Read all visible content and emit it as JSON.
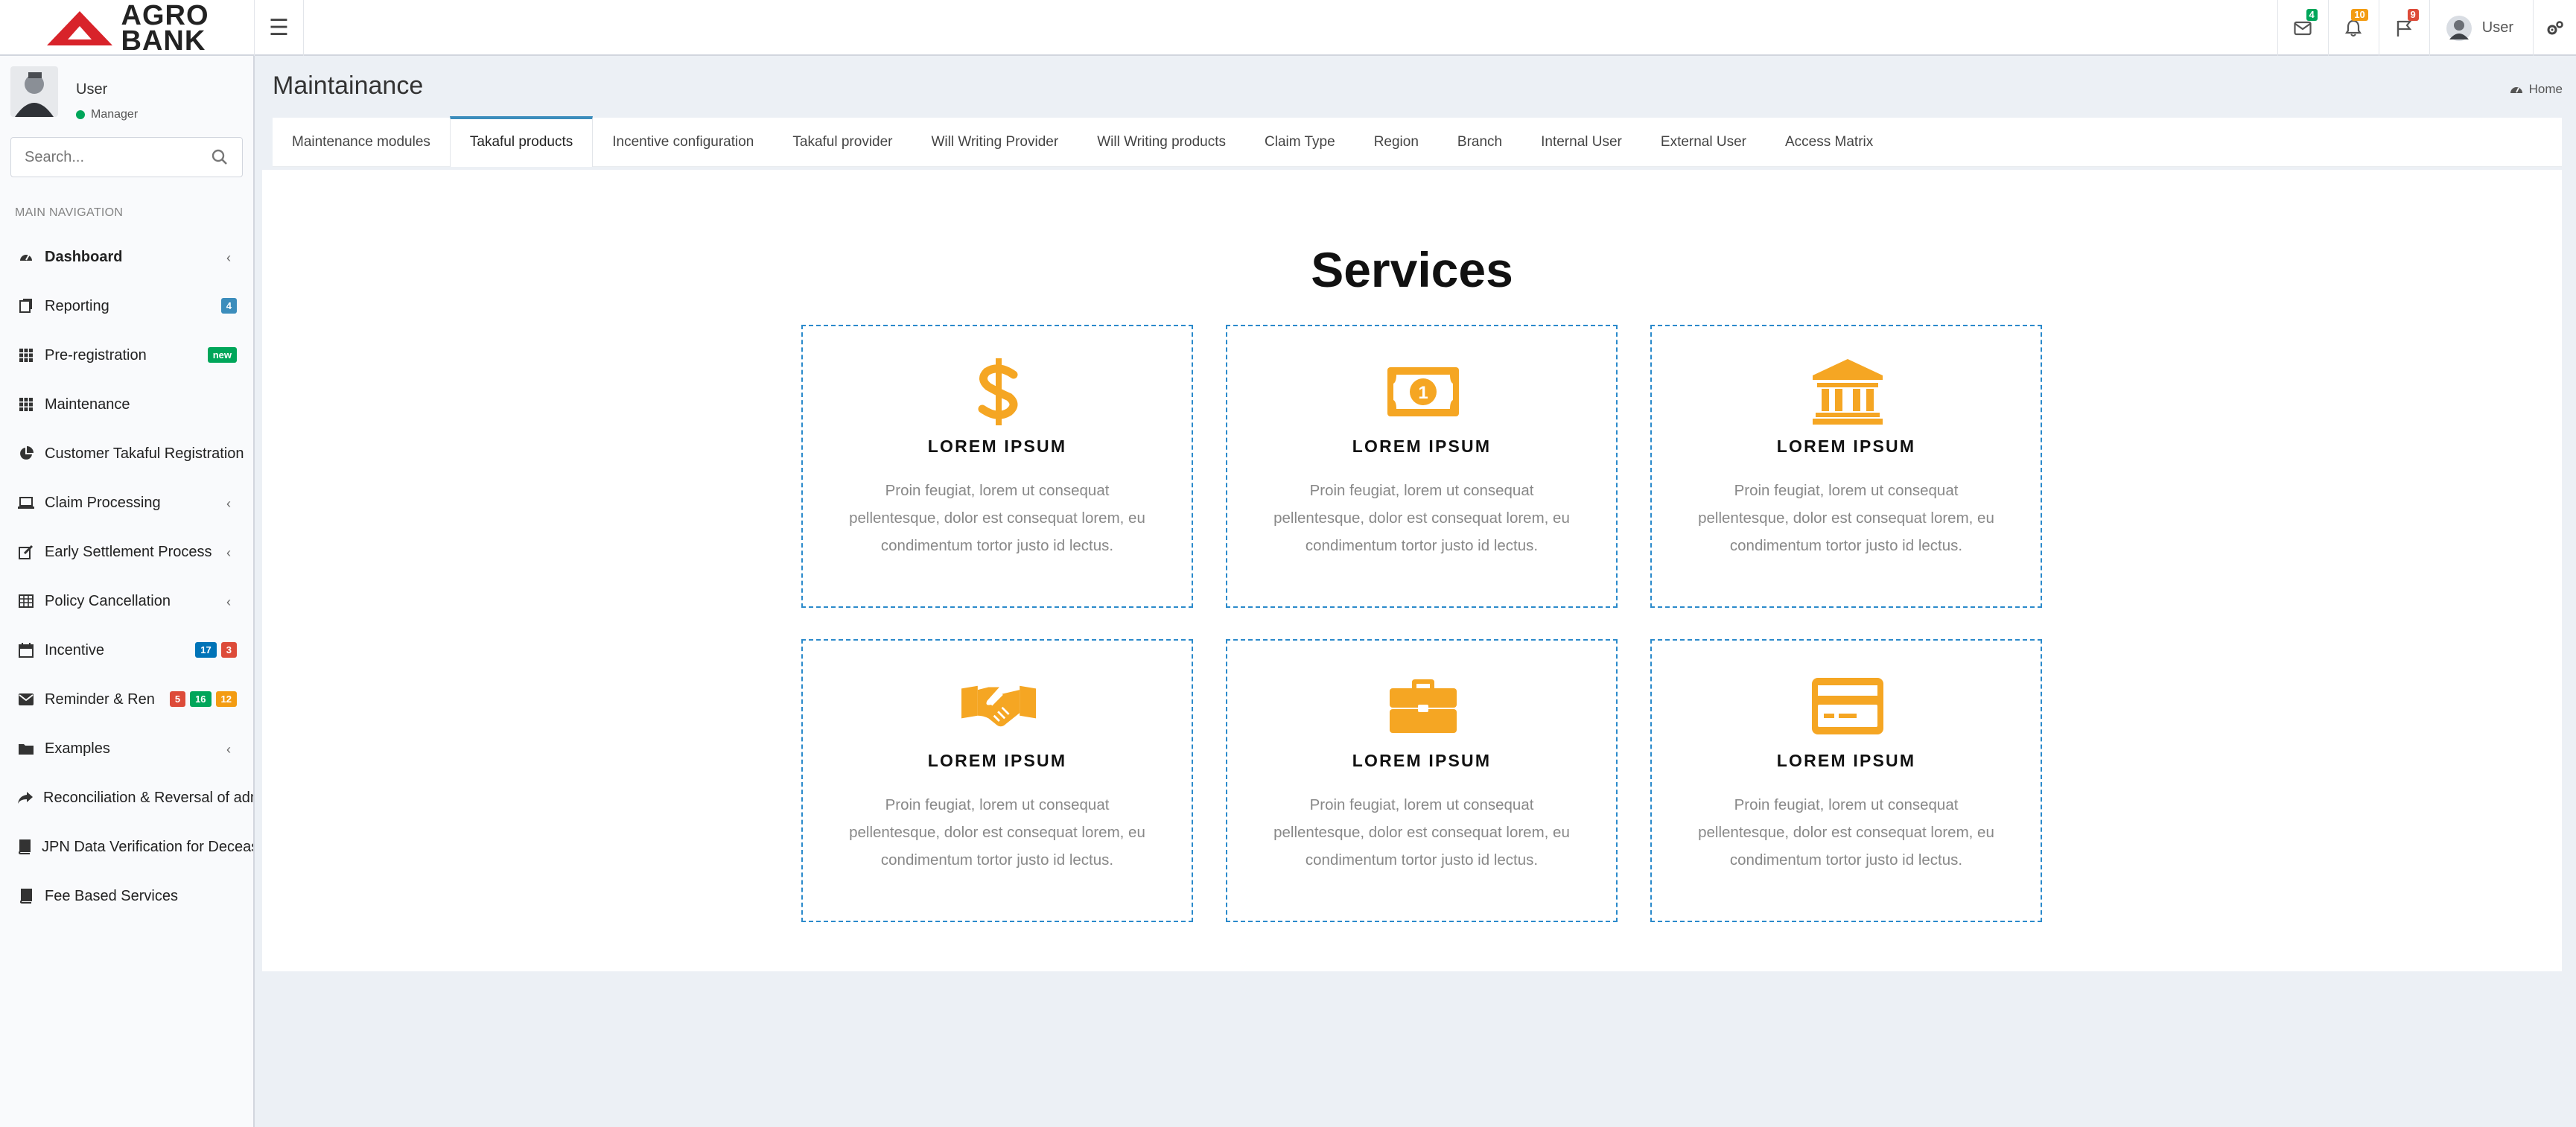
{
  "brand": {
    "logo_text_line1": "AGRO",
    "logo_text_line2": "BANK",
    "red": "#d8232a"
  },
  "header": {
    "badges": {
      "messages": "4",
      "notifications": "10",
      "tasks": "9"
    },
    "user_label": "User"
  },
  "sidebar": {
    "user": {
      "name": "User",
      "role": "Manager"
    },
    "search": {
      "placeholder": "Search..."
    },
    "nav_header": "MAIN NAVIGATION",
    "items": [
      {
        "label": "Dashboard",
        "icon": "dashboard-icon"
      },
      {
        "label": "Reporting",
        "icon": "reporting-icon",
        "badge": "4"
      },
      {
        "label": "Pre-registration",
        "icon": "grid-icon",
        "badge": "new"
      },
      {
        "label": "Maintenance",
        "icon": "grid-icon"
      },
      {
        "label": "Customer Takaful Registration",
        "icon": "pie-chart-icon"
      },
      {
        "label": "Claim Processing",
        "icon": "laptop-icon"
      },
      {
        "label": "Early Settlement Process",
        "icon": "edit-icon"
      },
      {
        "label": "Policy Cancellation",
        "icon": "table-icon"
      },
      {
        "label": "Incentive",
        "icon": "calendar-icon",
        "badges": [
          "17",
          "3"
        ]
      },
      {
        "label": "Reminder & Renewal",
        "icon": "envelope-icon",
        "badges": [
          "5",
          "16",
          "12"
        ]
      },
      {
        "label": "Examples",
        "icon": "folder-icon"
      },
      {
        "label": "Reconciliation & Reversal of admin",
        "icon": "share-icon"
      },
      {
        "label": "JPN Data Verification for Deceased",
        "icon": "book-icon"
      },
      {
        "label": "Fee Based Services",
        "icon": "book-icon"
      }
    ]
  },
  "content": {
    "page_title": "Maintainance",
    "breadcrumb_home": "Home",
    "tabs": [
      "Maintenance modules",
      "Takaful products",
      "Incentive configuration",
      "Takaful provider",
      "Will Writing Provider",
      "Will Writing products",
      "Claim Type",
      "Region",
      "Branch",
      "Internal User",
      "External User",
      "Access Matrix"
    ],
    "active_tab": "Takaful products",
    "services_title": "Services",
    "cards": [
      {
        "icon": "dollar-icon",
        "title": "LOREM IPSUM",
        "desc": "Proin feugiat, lorem ut consequat pellentesque, dolor est consequat lorem, eu condimentum tortor justo id lectus."
      },
      {
        "icon": "money-bill-icon",
        "title": "LOREM IPSUM",
        "desc": "Proin feugiat, lorem ut consequat pellentesque, dolor est consequat lorem, eu condimentum tortor justo id lectus."
      },
      {
        "icon": "bank-icon",
        "title": "LOREM IPSUM",
        "desc": "Proin feugiat, lorem ut consequat pellentesque, dolor est consequat lorem, eu condimentum tortor justo id lectus."
      },
      {
        "icon": "handshake-icon",
        "title": "LOREM IPSUM",
        "desc": "Proin feugiat, lorem ut consequat pellentesque, dolor est consequat lorem, eu condimentum tortor justo id lectus."
      },
      {
        "icon": "briefcase-icon",
        "title": "LOREM IPSUM",
        "desc": "Proin feugiat, lorem ut consequat pellentesque, dolor est consequat lorem, eu condimentum tortor justo id lectus."
      },
      {
        "icon": "credit-card-icon",
        "title": "LOREM IPSUM",
        "desc": "Proin feugiat, lorem ut consequat pellentesque, dolor est consequat lorem, eu condimentum tortor justo id lectus."
      }
    ]
  },
  "colors": {
    "icon_accent": "#f5a623",
    "badge_blue": "#3c8dbc",
    "badge_green": "#00a65a",
    "badge_red": "#dd4b39",
    "badge_orange": "#f39c12",
    "badge_navy": "#0073b7",
    "card_border": "#2b8acb"
  }
}
